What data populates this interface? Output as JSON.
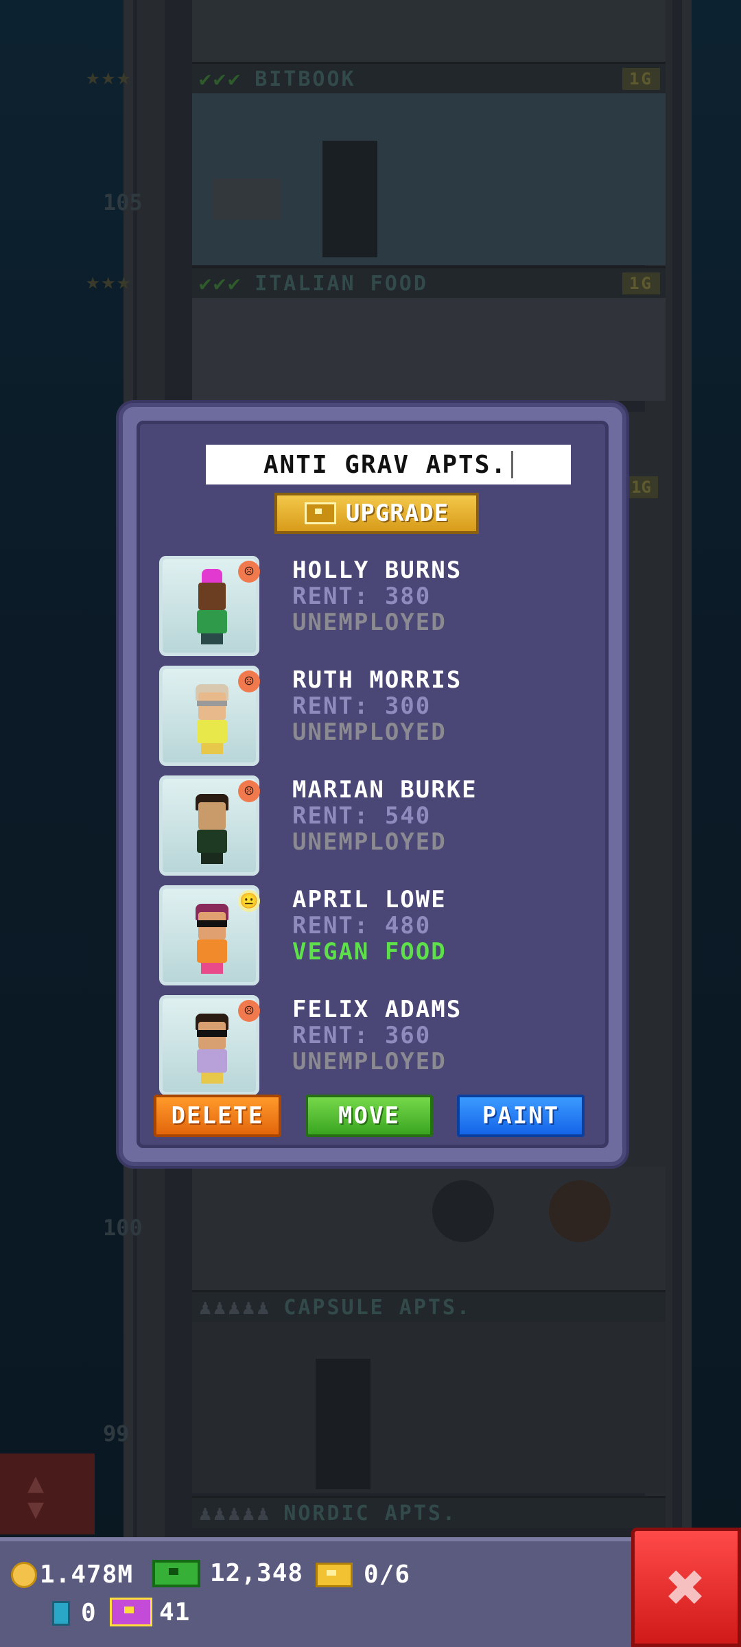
{
  "background": {
    "floors": [
      {
        "label": "BITBOOK",
        "pill": "1G",
        "checks": "✔✔✔",
        "stars": "★★★"
      },
      {
        "label": "ITALIAN FOOD",
        "pill": "1G",
        "checks": "✔✔✔",
        "stars": "★★★"
      },
      {
        "label": "CAPSULE APTS.",
        "checks": "♟♟♟♟♟"
      },
      {
        "label": "NORDIC APTS.",
        "checks": "♟♟♟♟♟"
      }
    ],
    "floor_numbers": [
      "105",
      "100",
      "99"
    ],
    "side_pill": "1G"
  },
  "modal": {
    "floor_name": "ANTI GRAV APTS.",
    "upgrade_label": "UPGRADE",
    "residents": [
      {
        "name": "HOLLY BURNS",
        "rent": "RENT: 380",
        "job": "UNEMPLOYED",
        "mood": "sad",
        "mood_glyph": "☹"
      },
      {
        "name": "RUTH MORRIS",
        "rent": "RENT: 300",
        "job": "UNEMPLOYED",
        "mood": "sad",
        "mood_glyph": "☹"
      },
      {
        "name": "MARIAN BURKE",
        "rent": "RENT: 540",
        "job": "UNEMPLOYED",
        "mood": "sad",
        "mood_glyph": "☹"
      },
      {
        "name": "APRIL LOWE",
        "rent": "RENT: 480",
        "job": "VEGAN FOOD",
        "mood": "neutral",
        "mood_glyph": "😐"
      },
      {
        "name": "FELIX ADAMS",
        "rent": "RENT: 360",
        "job": "UNEMPLOYED",
        "mood": "sad",
        "mood_glyph": "☹"
      }
    ],
    "buttons": {
      "delete": "DELETE",
      "move": "MOVE",
      "paint": "PAINT"
    }
  },
  "status_bar": {
    "coins": "1.478M",
    "bux": "12,348",
    "vip": "0/6",
    "keys": "0",
    "golden_tickets": "41"
  },
  "close_glyph": "✖",
  "scroll_glyphs": {
    "up": "▲",
    "down": "▼"
  },
  "colors": {
    "modal_bg": "#4a4675",
    "employed_text": "#5ee04a",
    "rent_text": "#8f8cbd",
    "delete_button": "#f07f1a",
    "move_button": "#4cc032",
    "paint_button": "#1f7df5",
    "close_button": "#e02a2a"
  }
}
